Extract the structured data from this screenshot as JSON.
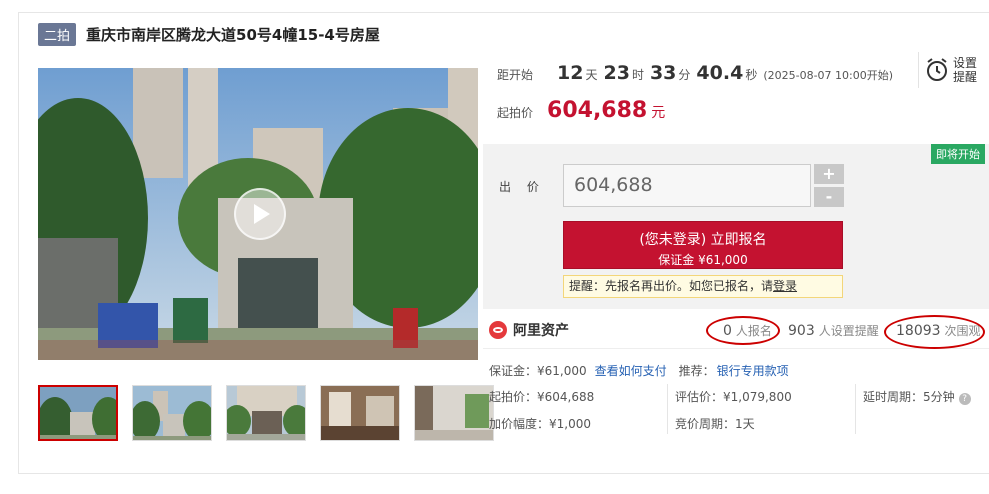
{
  "header": {
    "round_tag": "二拍",
    "title": "重庆市南岸区腾龙大道50号4幢15-4号房屋"
  },
  "countdown": {
    "label": "距开始",
    "days": "12",
    "days_unit": "天",
    "hours": "23",
    "hours_unit": "时",
    "minutes": "33",
    "minutes_unit": "分",
    "seconds": "40.4",
    "seconds_unit": "秒",
    "start_time": "(2025-08-07 10:00开始)"
  },
  "remind": {
    "label_line1": "设置",
    "label_line2": "提醒",
    "icon": "alarm-clock-icon"
  },
  "start_price": {
    "label": "起拍价",
    "value": "604,688",
    "unit": "元"
  },
  "bid": {
    "status_badge": "即将开始",
    "label": "出 价",
    "input_value": "604,688",
    "plus": "+",
    "minus": "-",
    "signup_line1": "(您未登录) 立即报名",
    "signup_line2": "保证金 ¥61,000",
    "tip_text": "提醒：先报名再出价。如您已报名，请",
    "tip_link": "登录"
  },
  "platform": {
    "name": "阿里资产",
    "signups": "0",
    "signups_label": "人报名",
    "reminders": "903",
    "reminders_label": "人设置提醒",
    "views": "18093",
    "views_label": "次围观"
  },
  "info": {
    "deposit": "保证金：¥61,000",
    "pay_link": "查看如何支付",
    "recommend_label": "推荐：",
    "loan_link": "银行专用款项",
    "start_price": "起拍价：¥604,688",
    "increment": "加价幅度：¥1,000",
    "appraisal": "评估价：¥1,079,800",
    "cycle": "竞价周期：1天",
    "delay": "延时周期：5分钟"
  },
  "colors": {
    "accent_red": "#c41230",
    "tag_bg": "#6a7795",
    "badge_green": "#2aa862",
    "link_blue": "#2661b3"
  }
}
